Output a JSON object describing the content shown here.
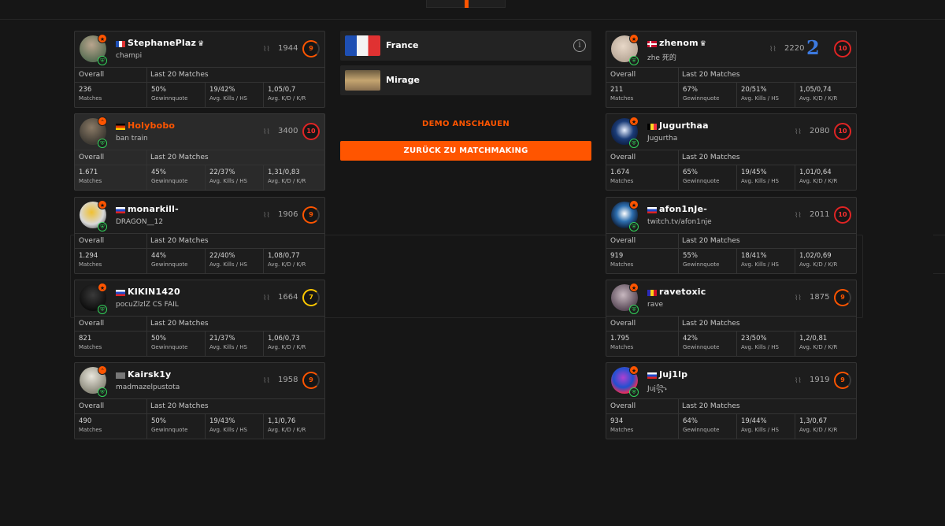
{
  "labels": {
    "overall": "Overall",
    "last20": "Last 20 Matches",
    "matches": "Matches",
    "winrate": "Gewinnquote",
    "kills_hs": "Avg. Kills / HS",
    "kdr": "Avg. K/D / K/R"
  },
  "colors": {
    "accent": "#ff5500",
    "background": "#161616",
    "card": "#1d1d1d"
  },
  "match": {
    "server": {
      "label": "France",
      "icon": "info-icon"
    },
    "map": {
      "label": "Mirage"
    },
    "demo_label": "DEMO ANSCHAUEN",
    "back_label": "ZURÜCK ZU MATCHMAKING"
  },
  "team_left": [
    {
      "name": "StephanePlaz",
      "crown": "♛",
      "sub": "champi",
      "elo": "1944",
      "level": "9",
      "overall_matches": "236",
      "winrate": "50%",
      "kills_hs": "19/42%",
      "kd_kr": "1,05/0,7"
    },
    {
      "name": "Holybobo",
      "crown": "",
      "sub": "ban train",
      "elo": "3400",
      "level": "10",
      "overall_matches": "1.671",
      "winrate": "45%",
      "kills_hs": "22/37%",
      "kd_kr": "1,31/0,83"
    },
    {
      "name": "monarkill-",
      "crown": "",
      "sub": "DRAGON__12",
      "elo": "1906",
      "level": "9",
      "overall_matches": "1.294",
      "winrate": "44%",
      "kills_hs": "22/40%",
      "kd_kr": "1,08/0,77"
    },
    {
      "name": "KIKIN1420",
      "crown": "",
      "sub": "pocuZlzlZ CS FAIL",
      "elo": "1664",
      "level": "7",
      "overall_matches": "821",
      "winrate": "50%",
      "kills_hs": "21/37%",
      "kd_kr": "1,06/0,73"
    },
    {
      "name": "Kairsk1y",
      "crown": "",
      "sub": "madmazelpustota",
      "elo": "1958",
      "level": "9",
      "overall_matches": "490",
      "winrate": "50%",
      "kills_hs": "19/43%",
      "kd_kr": "1,1/0,76"
    }
  ],
  "team_right": [
    {
      "name": "zhenom",
      "crown": "♛",
      "sub": "zhe 死的",
      "elo": "2220",
      "level": "10",
      "overall_matches": "211",
      "winrate": "67%",
      "kills_hs": "20/51%",
      "kd_kr": "1,05/0,74"
    },
    {
      "name": "Jugurthaa",
      "crown": "",
      "sub": "Jugurtha",
      "elo": "2080",
      "level": "10",
      "overall_matches": "1.674",
      "winrate": "65%",
      "kills_hs": "19/45%",
      "kd_kr": "1,01/0,64"
    },
    {
      "name": "afon1nJe-",
      "crown": "",
      "sub": "twitch.tv/afon1nje",
      "elo": "2011",
      "level": "10",
      "overall_matches": "919",
      "winrate": "55%",
      "kills_hs": "18/41%",
      "kd_kr": "1,02/0,69"
    },
    {
      "name": "ravetoxic",
      "crown": "",
      "sub": "rave",
      "elo": "1875",
      "level": "9",
      "overall_matches": "1.795",
      "winrate": "42%",
      "kills_hs": "23/50%",
      "kd_kr": "1,2/0,81"
    },
    {
      "name": "Juj1lp",
      "crown": "",
      "sub": "Juj꧂",
      "elo": "1919",
      "level": "9",
      "overall_matches": "934",
      "winrate": "64%",
      "kills_hs": "19/44%",
      "kd_kr": "1,3/0,67"
    }
  ]
}
